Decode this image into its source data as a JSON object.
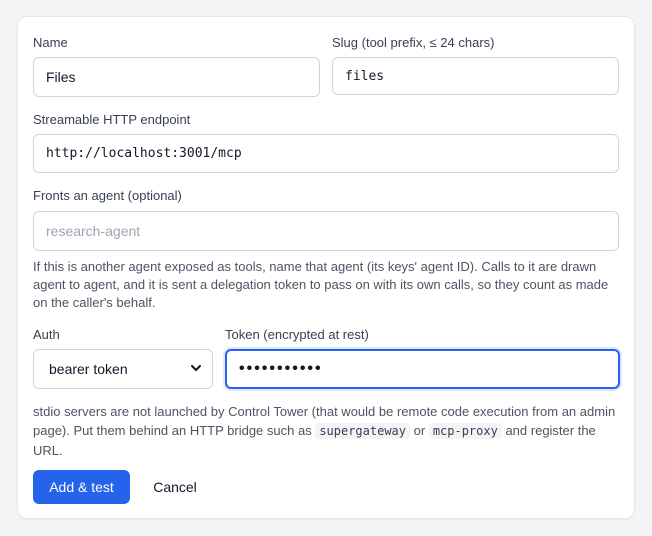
{
  "form": {
    "name": {
      "label": "Name",
      "value": "Files"
    },
    "slug": {
      "label": "Slug (tool prefix, ≤ 24 chars)",
      "value": "files"
    },
    "endpoint": {
      "label": "Streamable HTTP endpoint",
      "value": "http://localhost:3001/mcp"
    },
    "fronts": {
      "label": "Fronts an agent (optional)",
      "placeholder": "research-agent",
      "value": "",
      "help": "If this is another agent exposed as tools, name that agent (its keys' agent ID). Calls to it are drawn agent to agent, and it is sent a delegation token to pass on with its own calls, so they count as made on the caller's behalf."
    },
    "auth": {
      "label": "Auth",
      "value": "bearer token"
    },
    "token": {
      "label": "Token (encrypted at rest)",
      "value": "•••••••••••"
    },
    "stdio_note": {
      "part1": "stdio servers are not launched by Control Tower (that would be remote code execution from an admin page). Put them behind an HTTP bridge such as ",
      "code1": "supergateway",
      "part2": " or ",
      "code2": "mcp-proxy",
      "part3": " and register the URL."
    }
  },
  "actions": {
    "submit_label": "Add & test",
    "cancel_label": "Cancel"
  },
  "colors": {
    "accent": "#2563eb",
    "focus_border": "#2563eb"
  },
  "icons": {
    "auth_select": "chevron-down-icon"
  }
}
